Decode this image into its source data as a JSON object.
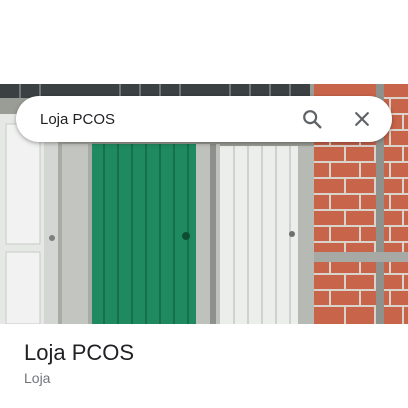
{
  "search": {
    "query": "Loja PCOS",
    "icons": {
      "search": "search-icon",
      "close": "close-icon"
    }
  },
  "place": {
    "name": "Loja PCOS",
    "category": "Loja"
  },
  "photo": {
    "description_icon": "storefront-photo"
  },
  "colors": {
    "green_door": "#1f8a5f",
    "brick": "#c7644a",
    "title_text": "#202124",
    "secondary_text": "#70757a",
    "icon": "#5f6368"
  }
}
